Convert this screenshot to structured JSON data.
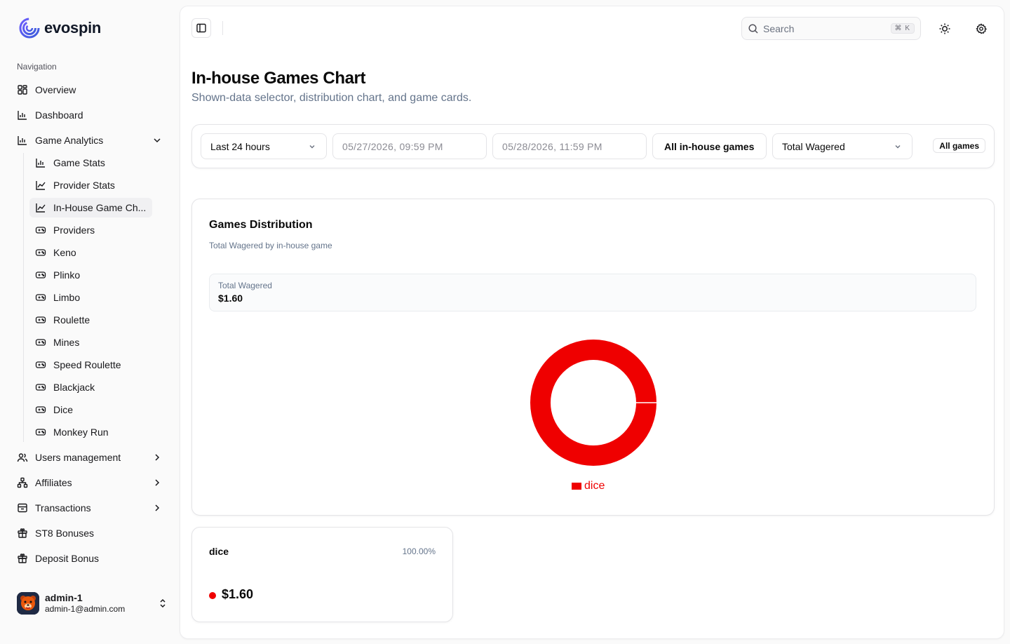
{
  "brand": {
    "name": "evospin"
  },
  "nav": {
    "heading": "Navigation",
    "overview": "Overview",
    "dashboard": "Dashboard",
    "game_analytics": "Game Analytics",
    "sub_items": [
      "Game Stats",
      "Provider Stats",
      "In-House Game Ch...",
      "Providers",
      "Keno",
      "Plinko",
      "Limbo",
      "Roulette",
      "Mines",
      "Speed Roulette",
      "Blackjack",
      "Dice",
      "Monkey Run"
    ],
    "users_management": "Users management",
    "affiliates": "Affiliates",
    "transactions": "Transactions",
    "st8_bonuses": "ST8 Bonuses",
    "deposit_bonus": "Deposit Bonus"
  },
  "user": {
    "name": "admin-1",
    "email": "admin-1@admin.com"
  },
  "header": {
    "search_placeholder": "Search",
    "shortcut": "⌘ K"
  },
  "page": {
    "title": "In-house Games Chart",
    "subtitle": "Shown-data selector, distribution chart, and game cards."
  },
  "filters": {
    "range": "Last 24 hours",
    "start": "05/27/2026, 09:59 PM",
    "end": "05/28/2026, 11:59 PM",
    "games": "All in-house games",
    "metric": "Total Wagered",
    "badge": "All games"
  },
  "distribution": {
    "title": "Games Distribution",
    "subtitle": "Total Wagered by in-house game",
    "total_label": "Total Wagered",
    "total_value": "$1.60"
  },
  "chart_data": {
    "type": "pie",
    "categories": [
      "dice"
    ],
    "values": [
      1.6
    ],
    "colors": [
      "#ef0000"
    ],
    "legend": "bottom"
  },
  "game_cards": [
    {
      "name": "dice",
      "percent": "100.00%",
      "value": "$1.60",
      "color": "#ef0000"
    }
  ]
}
